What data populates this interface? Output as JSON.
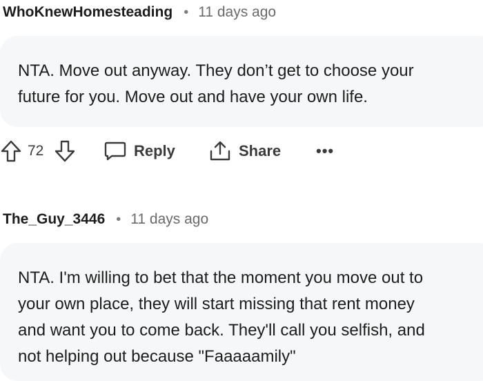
{
  "comments": [
    {
      "author": "WhoKnewHomesteading",
      "separator": "•",
      "time": "11 days ago",
      "body_lines": [
        "NTA. Move out anyway. They don’t get to choose your",
        "future for you. Move out and have your own life."
      ],
      "score": "72",
      "reply_label": "Reply",
      "share_label": "Share",
      "more_label": "•••",
      "icons": [
        "upvote-icon",
        "downvote-icon",
        "reply-bubble-icon",
        "share-icon",
        "more-icon"
      ]
    },
    {
      "author": "The_Guy_3446",
      "separator": "•",
      "time": "11 days ago",
      "body_lines": [
        "NTA. I'm willing to bet that the moment you move out to",
        "your own place, they will start missing that rent money",
        "and want you to come back. They'll call you selfish, and",
        "not helping out because \"Faaaaamily\""
      ]
    }
  ],
  "colors": {
    "bubble_background": "#f6f7f8",
    "meta_text": "#6a6a6a",
    "icon": "#3a3a3a"
  }
}
